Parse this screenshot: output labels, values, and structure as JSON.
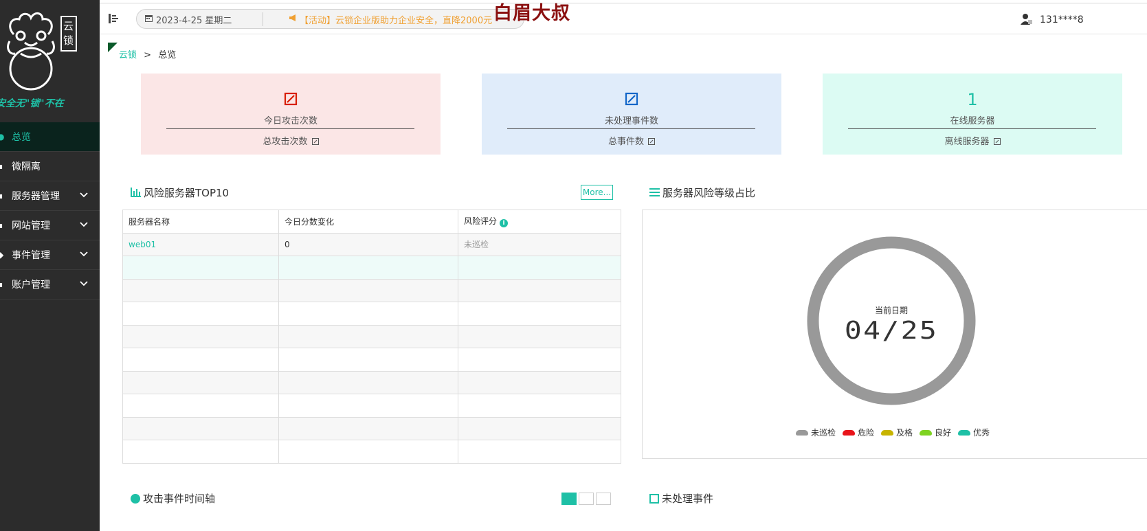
{
  "sidebar": {
    "logo_badge": "云锁",
    "slogan": "安全无\"锁\"不在",
    "items": [
      {
        "label": "总览",
        "active": true,
        "icon": "dashboard-icon"
      },
      {
        "label": "微隔离",
        "icon": "micro-isolation-icon"
      },
      {
        "label": "服务器管理",
        "icon": "server-icon",
        "expandable": true
      },
      {
        "label": "网站管理",
        "icon": "website-icon",
        "expandable": true
      },
      {
        "label": "事件管理",
        "icon": "event-icon",
        "expandable": true
      },
      {
        "label": "账户管理",
        "icon": "account-icon",
        "expandable": true
      }
    ]
  },
  "topbar": {
    "date": "2023-4-25 星期二",
    "promo": "【活动】云锁企业版助力企业安全，直降2000元",
    "brand": "白眉大叔",
    "user": "131****8"
  },
  "breadcrumb": {
    "root": "云锁",
    "separator": ">",
    "current": "总览"
  },
  "stats": [
    {
      "value": "",
      "label": "今日攻击次数",
      "sub": "总攻击次数",
      "color": "#d81e06",
      "bg": "#fbe6e6"
    },
    {
      "value": "",
      "label": "未处理事件数",
      "sub": "总事件数",
      "color": "#1266c8",
      "bg": "#e0ecfa"
    },
    {
      "value": "1",
      "label": "在线服务器",
      "sub": "离线服务器",
      "color": "#1ec0a6",
      "bg": "#dcfbf3"
    }
  ],
  "risk_panel": {
    "title": "风险服务器TOP10",
    "more": "More...",
    "columns": [
      "服务器名称",
      "今日分数变化",
      "风险评分"
    ],
    "rows": [
      [
        "web01",
        "0",
        "未巡检"
      ],
      [
        "",
        "",
        ""
      ],
      [
        "",
        "",
        ""
      ],
      [
        "",
        "",
        ""
      ],
      [
        "",
        "",
        ""
      ],
      [
        "",
        "",
        ""
      ],
      [
        "",
        "",
        ""
      ],
      [
        "",
        "",
        ""
      ],
      [
        "",
        "",
        ""
      ],
      [
        "",
        "",
        ""
      ]
    ]
  },
  "pie_panel": {
    "title": "服务器风险等级占比",
    "center_label": "当前日期",
    "center_value": "04/25",
    "legend": [
      {
        "name": "未巡检",
        "color": "#999999"
      },
      {
        "name": "危险",
        "color": "#e8141a"
      },
      {
        "name": "及格",
        "color": "#c8b400"
      },
      {
        "name": "良好",
        "color": "#7ed321"
      },
      {
        "name": "优秀",
        "color": "#1ec0a6"
      }
    ]
  },
  "bottom": {
    "timeline_title": "攻击事件时间轴",
    "pending_title": "未处理事件"
  }
}
